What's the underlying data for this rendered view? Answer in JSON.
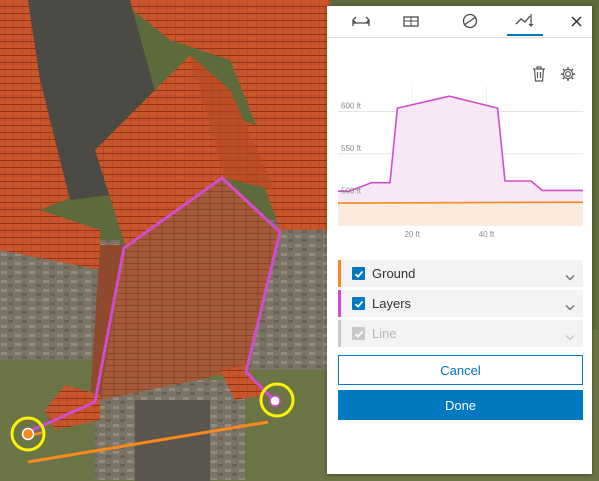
{
  "panel": {
    "tabs": [
      {
        "icon": "distance-measure-icon",
        "active": false
      },
      {
        "icon": "area-measure-icon",
        "active": false
      },
      {
        "icon": "slope-measure-icon",
        "active": false
      },
      {
        "icon": "elevation-profile-icon",
        "active": true
      }
    ],
    "close_icon": "close-icon",
    "tools": [
      "trash-icon",
      "settings-gear-icon"
    ],
    "legend": [
      {
        "label": "Ground",
        "checked": true,
        "enabled": true,
        "color": "#f7891e"
      },
      {
        "label": "Layers",
        "checked": true,
        "enabled": true,
        "color": "#cf4ecb"
      },
      {
        "label": "Line",
        "checked": true,
        "enabled": false,
        "color": "#c8c8c8"
      }
    ],
    "cancel_label": "Cancel",
    "done_label": "Done"
  },
  "chart_data": {
    "type": "area",
    "x_unit": "ft",
    "y_unit": "ft",
    "xlim": [
      0,
      66
    ],
    "ylim": [
      465,
      630
    ],
    "y_ticks": [
      {
        "value": 500,
        "label": "500 ft"
      },
      {
        "value": 550,
        "label": "550 ft"
      },
      {
        "value": 600,
        "label": "600 ft"
      }
    ],
    "x_ticks": [
      {
        "value": 20,
        "label": "20 ft"
      },
      {
        "value": 40,
        "label": "40 ft"
      }
    ],
    "grid": true,
    "series": [
      {
        "name": "Layers",
        "color": "#cf4ecb",
        "fill": "#f6e4f6",
        "x": [
          0,
          3,
          9,
          14,
          16,
          30,
          43,
          45,
          52,
          55,
          66
        ],
        "y": [
          506,
          506,
          516,
          516,
          604,
          618,
          604,
          518,
          518,
          507,
          507
        ]
      },
      {
        "name": "Ground",
        "color": "#f7891e",
        "fill": "#fdebd8",
        "x": [
          0,
          66
        ],
        "y": [
          492,
          493
        ]
      }
    ]
  },
  "map": {
    "measure_line_color": "#cf4ecb",
    "ground_line_color": "#f7891e",
    "highlight_ring_color": "#fff200"
  }
}
